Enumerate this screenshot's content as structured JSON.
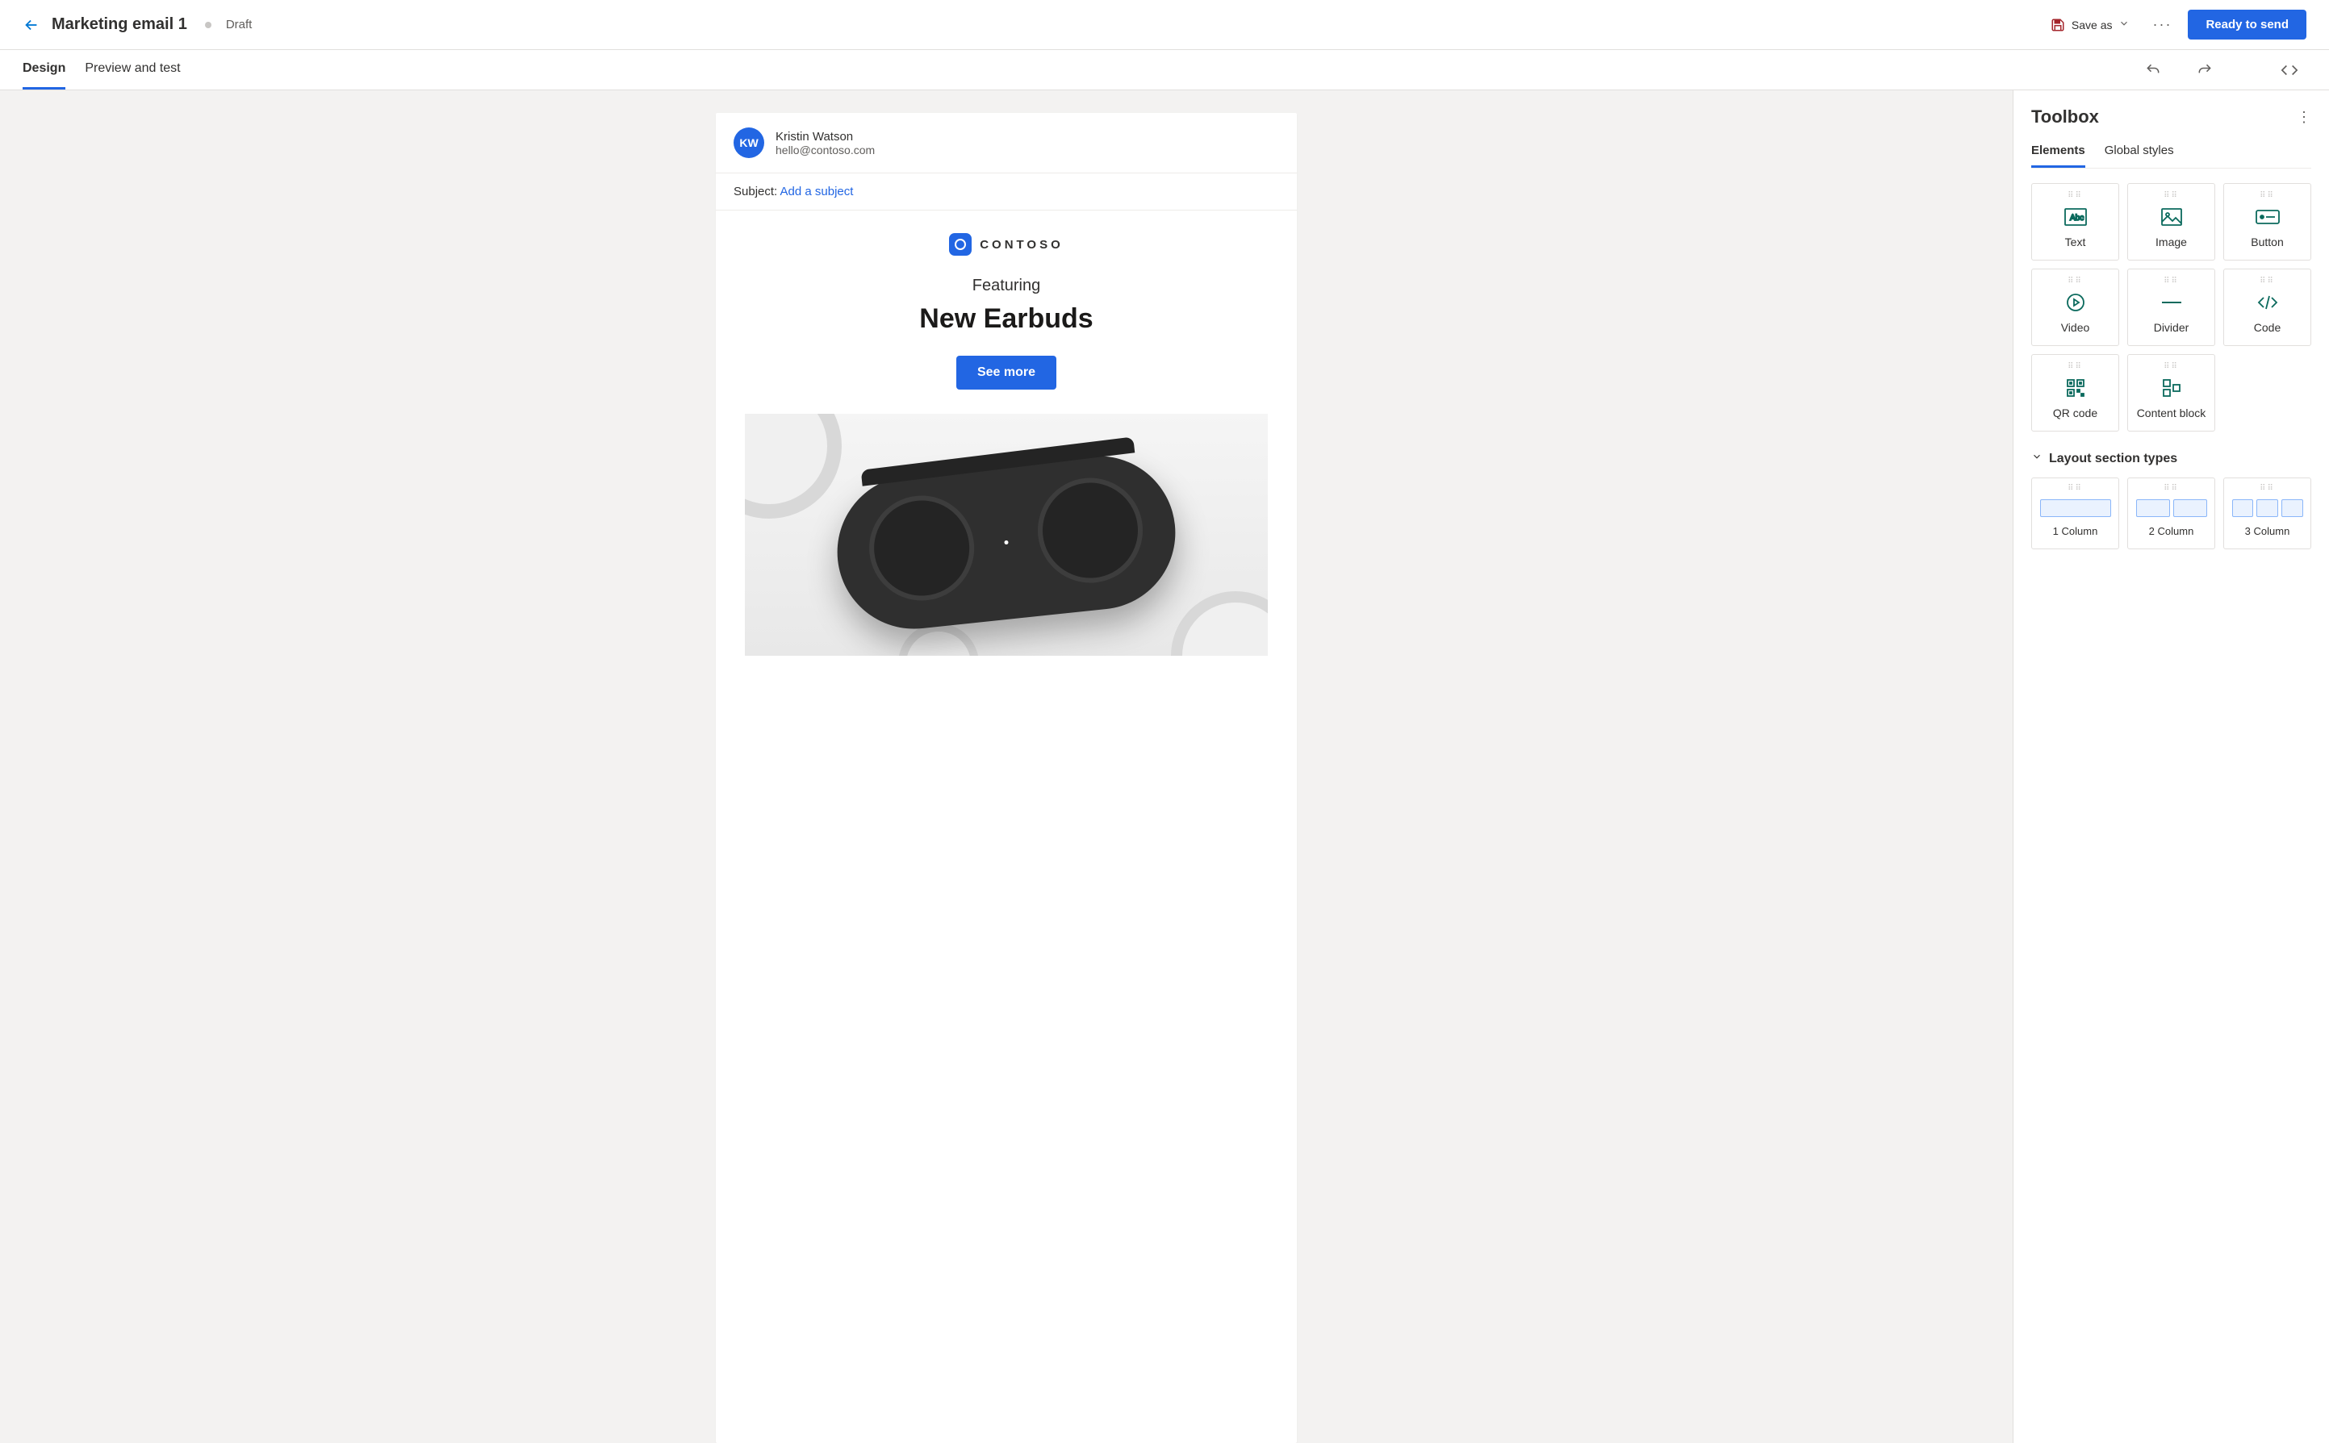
{
  "header": {
    "title": "Marketing email 1",
    "status": "Draft",
    "save_as": "Save as",
    "ready_btn": "Ready to send"
  },
  "tabs": {
    "design": "Design",
    "preview": "Preview and test"
  },
  "sender": {
    "initials": "KW",
    "name": "Kristin Watson",
    "email": "hello@contoso.com"
  },
  "subject": {
    "label": "Subject:",
    "link": "Add a subject"
  },
  "email": {
    "brand": "CONTOSO",
    "featuring": "Featuring",
    "hero_title": "New Earbuds",
    "cta": "See more"
  },
  "toolbox": {
    "title": "Toolbox",
    "tabs": {
      "elements": "Elements",
      "global": "Global styles"
    },
    "elements": [
      {
        "label": "Text"
      },
      {
        "label": "Image"
      },
      {
        "label": "Button"
      },
      {
        "label": "Video"
      },
      {
        "label": "Divider"
      },
      {
        "label": "Code"
      },
      {
        "label": "QR code"
      },
      {
        "label": "Content block"
      }
    ],
    "layout_header": "Layout section types",
    "layouts": [
      {
        "label": "1 Column"
      },
      {
        "label": "2 Column"
      },
      {
        "label": "3 Column"
      }
    ]
  }
}
